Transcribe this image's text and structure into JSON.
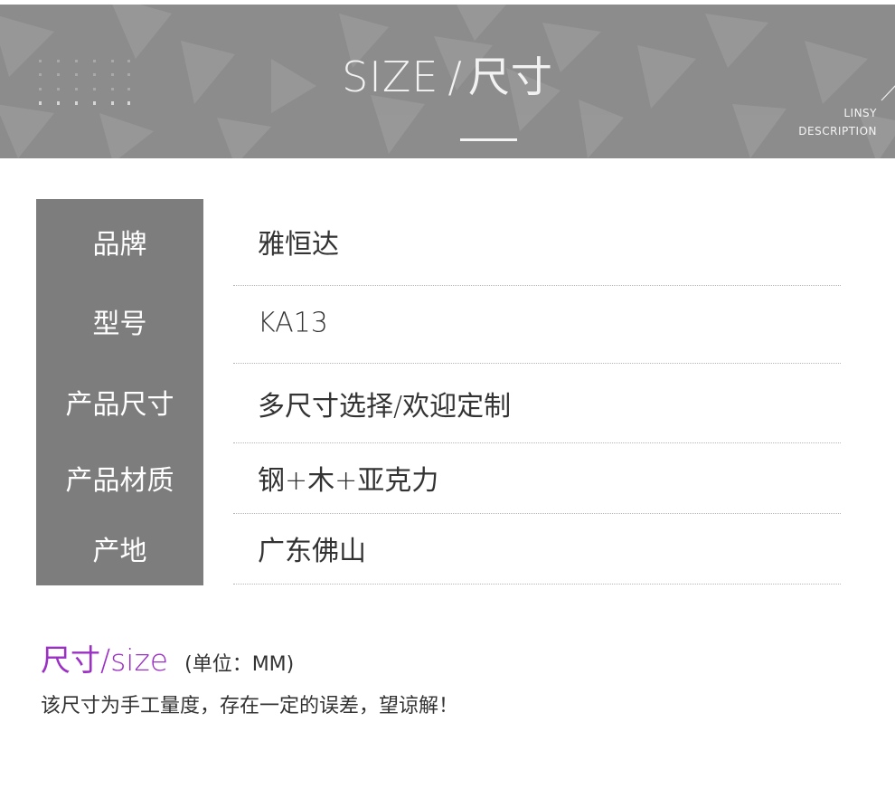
{
  "banner": {
    "title_en": "SIZE",
    "title_sep": "/",
    "title_cn": "尺寸",
    "brand_line1": "LINSY",
    "brand_line2": "DESCRIPTION",
    "background_color": "#8c8c8c"
  },
  "specs": [
    {
      "label": "品牌",
      "value": "雅恒达"
    },
    {
      "label": "型号",
      "value": "KA13"
    },
    {
      "label": "产品尺寸",
      "value": "多尺寸选择/欢迎定制"
    },
    {
      "label": "产品材质",
      "value": "钢+木+亚克力"
    },
    {
      "label": "产地",
      "value": "广东佛山"
    }
  ],
  "size_section": {
    "title": "尺寸/size",
    "unit": "(单位：MM)",
    "note": "该尺寸为手工量度，存在一定的误差，望谅解！",
    "accent_color": "#9b2fc6"
  }
}
